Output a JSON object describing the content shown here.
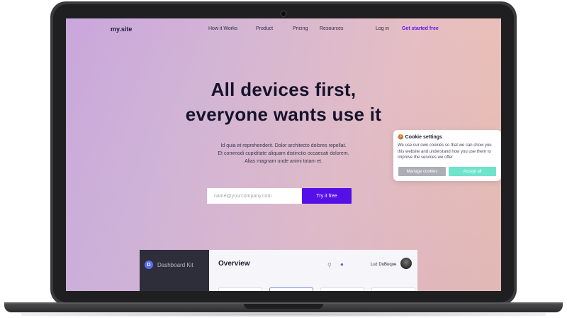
{
  "nav": {
    "logo": "my.site",
    "links": [
      "How it Works",
      "Product",
      "Pricing",
      "Resources"
    ],
    "login": "Log in",
    "cta": "Get started free"
  },
  "hero": {
    "title_line1": "All devices first,",
    "title_line2": "everyone wants use it",
    "subtitle_lines": [
      "Id quia et reprehenderit. Dolor architecto dolores repellat.",
      "Et commodi cupiditate aliquam distinctio occaecati dolorem.",
      "Alias magnam unde animi totam et."
    ],
    "email_placeholder": "name@yourcompany.com",
    "button": "Try it free"
  },
  "dashboard": {
    "logo_letter": "D",
    "brand": "Dashboard Kit",
    "title": "Overview",
    "user": "Luz DuBuque",
    "search_icon": "search-icon",
    "bell_icon": "bell-icon"
  },
  "cookie": {
    "emoji": "🍪",
    "title": "Cookie settings",
    "text": "We use our own cookies so that we can show you this website and understand how you use them to improve the services we offer",
    "manage": "Manage cookies",
    "accept": "Accept all"
  },
  "colors": {
    "accent": "#5510e8",
    "accept": "#6fe3cc",
    "manage": "#adadb7"
  }
}
